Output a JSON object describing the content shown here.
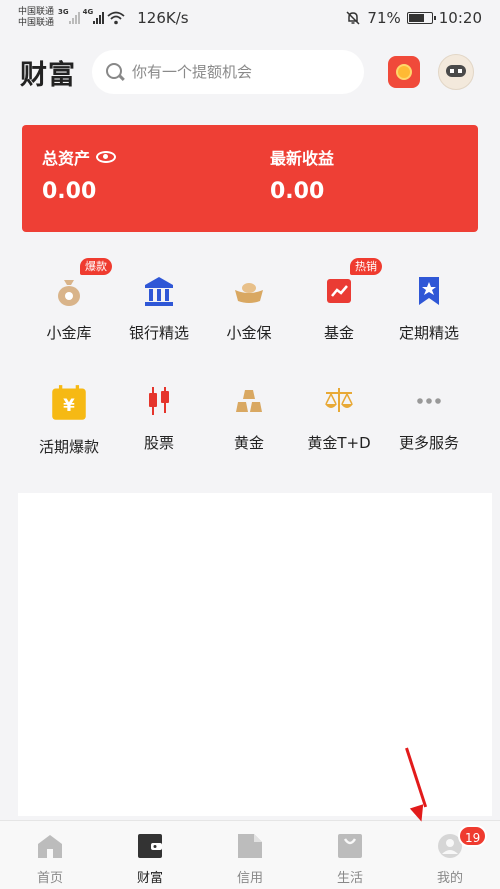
{
  "status_bar": {
    "carrier_1": "中国联通",
    "carrier_2": "中国联通",
    "net_1": "3G",
    "net_2": "4G",
    "net_speed": "126K/s",
    "battery": "71%",
    "battery_level": 0.71,
    "time": "10:20"
  },
  "header": {
    "title": "财富",
    "search_placeholder": "你有一个提额机会"
  },
  "assets": {
    "total_label": "总资产",
    "total_value": "0.00",
    "income_label": "最新收益",
    "income_value": "0.00",
    "card_color": "#ee3f35"
  },
  "services": {
    "row1": [
      {
        "label": "小金库",
        "badge": "爆款",
        "icon": "money-bag-icon"
      },
      {
        "label": "银行精选",
        "badge": "",
        "icon": "bank-icon"
      },
      {
        "label": "小金保",
        "badge": "",
        "icon": "gold-ingot-icon"
      },
      {
        "label": "基金",
        "badge": "热销",
        "icon": "fund-chart-icon"
      },
      {
        "label": "定期精选",
        "badge": "",
        "icon": "bookmark-star-icon"
      }
    ],
    "row2": [
      {
        "label": "活期爆款",
        "icon": "yuan-calendar-icon"
      },
      {
        "label": "股票",
        "icon": "candlestick-icon"
      },
      {
        "label": "黄金",
        "icon": "gold-bars-icon"
      },
      {
        "label": "黄金T+D",
        "icon": "scale-icon"
      },
      {
        "label": "更多服务",
        "icon": "more-dots-icon"
      }
    ]
  },
  "tabbar": {
    "tabs": [
      {
        "label": "首页",
        "icon": "home-icon"
      },
      {
        "label": "财富",
        "icon": "wallet-icon"
      },
      {
        "label": "信用",
        "icon": "credit-card-icon"
      },
      {
        "label": "生活",
        "icon": "shopping-bag-icon"
      },
      {
        "label": "我的",
        "icon": "profile-icon"
      }
    ],
    "active": "财富",
    "me_badge": "19"
  }
}
